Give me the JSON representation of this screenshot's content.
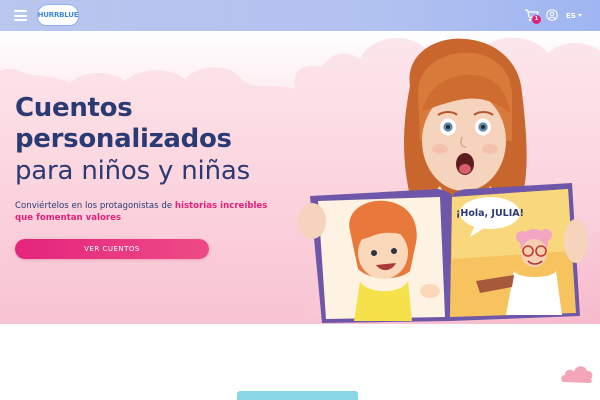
{
  "header": {
    "logo_text": "HURRBLUE",
    "cart_count": "1",
    "language": "ES"
  },
  "icons": {
    "menu": "hamburger-menu-icon",
    "cart": "shopping-cart-icon",
    "user": "user-account-icon",
    "caret": "chevron-down-icon"
  },
  "hero": {
    "title_line1": "Cuentos",
    "title_line2": "personalizados",
    "title_line3": "para niños y niñas",
    "subtitle_prefix": "Conviértelos en los protagonistas de ",
    "subtitle_highlight": "historias increíbles que fomentan valores",
    "cta_label": "VER CUENTOS",
    "book_speech": "¡Hola, JULIA!"
  },
  "colors": {
    "header_bg": "#b3c2f0",
    "title": "#2c3a73",
    "accent_pink": "#e0227a",
    "hero_bg": "#fcdbe3",
    "teaser": "#8ad7e8"
  }
}
